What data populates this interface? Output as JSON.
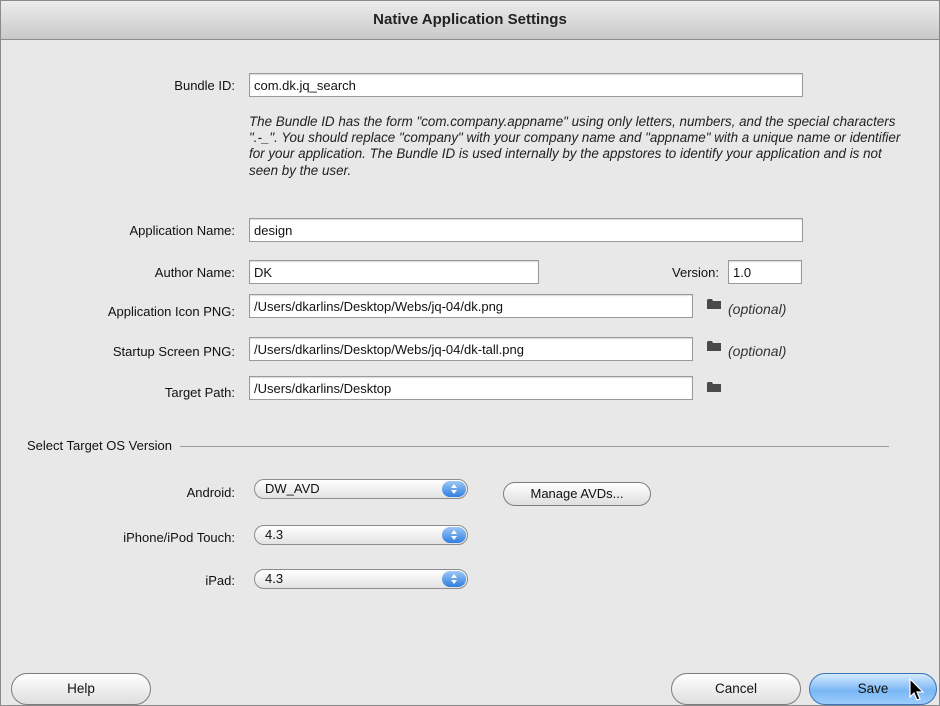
{
  "window": {
    "title": "Native Application Settings"
  },
  "form": {
    "bundle_id": {
      "label": "Bundle ID:",
      "value": "com.dk.jq_search"
    },
    "help_text": "The Bundle ID has the form \"com.company.appname\" using only letters, numbers, and the special characters \".-_\". You should replace \"company\" with your company name and \"appname\" with a unique name or identifier for your application. The Bundle ID is used internally by the appstores to identify your application and is not seen by the user.",
    "app_name": {
      "label": "Application Name:",
      "value": "design"
    },
    "author_name": {
      "label": "Author Name:",
      "value": "DK"
    },
    "version": {
      "label": "Version:",
      "value": "1.0"
    },
    "app_icon": {
      "label": "Application Icon PNG:",
      "value": "/Users/dkarlins/Desktop/Webs/jq-04/dk.png",
      "optional": "(optional)"
    },
    "startup_screen": {
      "label": "Startup Screen PNG:",
      "value": "/Users/dkarlins/Desktop/Webs/jq-04/dk-tall.png",
      "optional": "(optional)"
    },
    "target_path": {
      "label": "Target Path:",
      "value": "/Users/dkarlins/Desktop"
    }
  },
  "target_os": {
    "section_title": "Select Target OS Version",
    "android": {
      "label": "Android:",
      "value": "DW_AVD"
    },
    "manage_avds": "Manage AVDs...",
    "iphone": {
      "label": "iPhone/iPod Touch:",
      "value": "4.3"
    },
    "ipad": {
      "label": "iPad:",
      "value": "4.3"
    }
  },
  "buttons": {
    "help": "Help",
    "cancel": "Cancel",
    "save": "Save"
  },
  "icons": {
    "folder": "folder-icon",
    "popup_arrows": "popup-arrows-icon",
    "cursor": "mouse-pointer-icon"
  },
  "colors": {
    "default_button": "#7ab7f5",
    "popup_arrows": "#2f7fe0"
  }
}
